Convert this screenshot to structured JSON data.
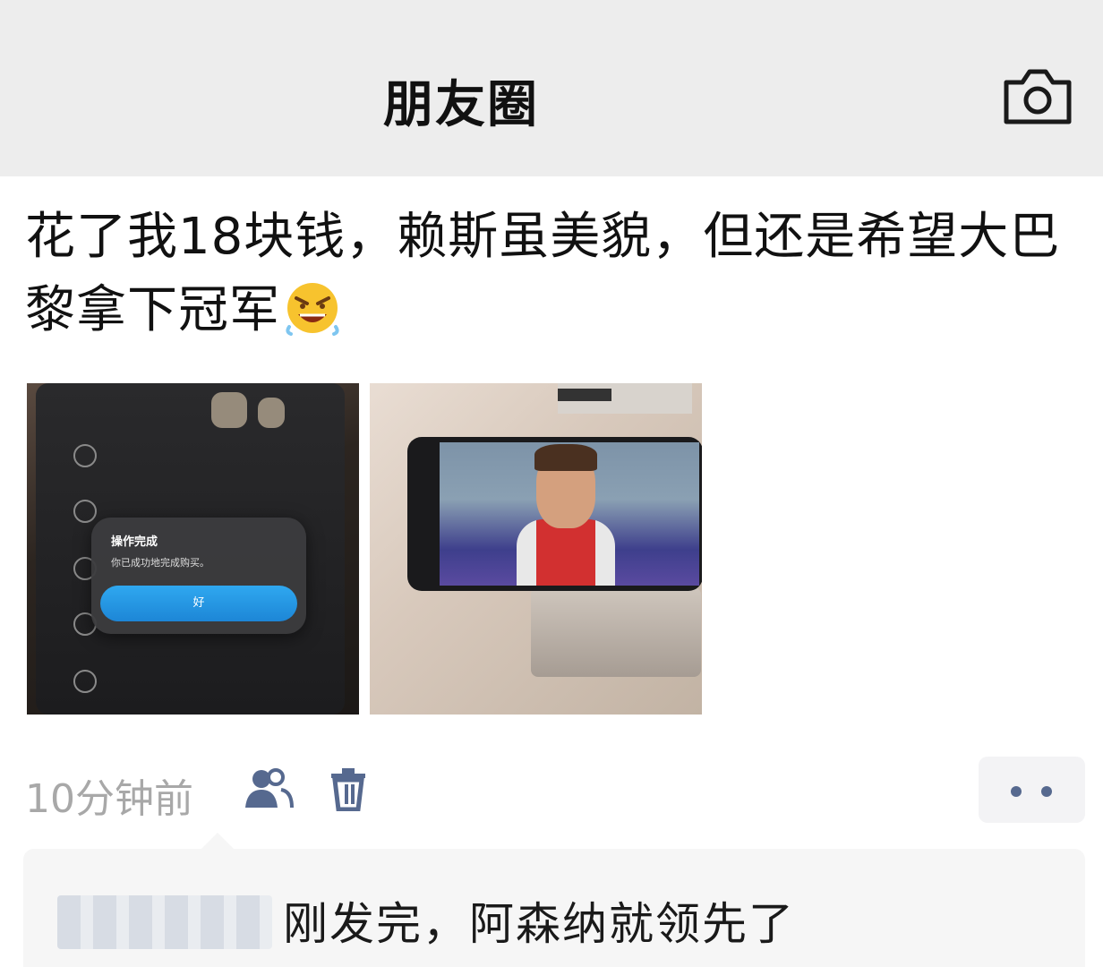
{
  "header": {
    "title": "朋友圈",
    "camera_icon": "camera-icon"
  },
  "post": {
    "text": "花了我18块钱，赖斯虽美貌，但还是希望大巴黎拿下冠军",
    "emoji": "grinning-angry-face-emoji",
    "photos": [
      {
        "screen_dialog_title": "操作完成",
        "screen_dialog_message": "你已成功地完成购买。",
        "screen_dialog_button": "好"
      },
      {}
    ],
    "time": "10分钟前",
    "visibility_icon": "people-icon",
    "delete_icon": "trash-icon",
    "more_icon": "more-dots-icon"
  },
  "comment": {
    "text": "刚发完，阿森纳就领先了"
  }
}
